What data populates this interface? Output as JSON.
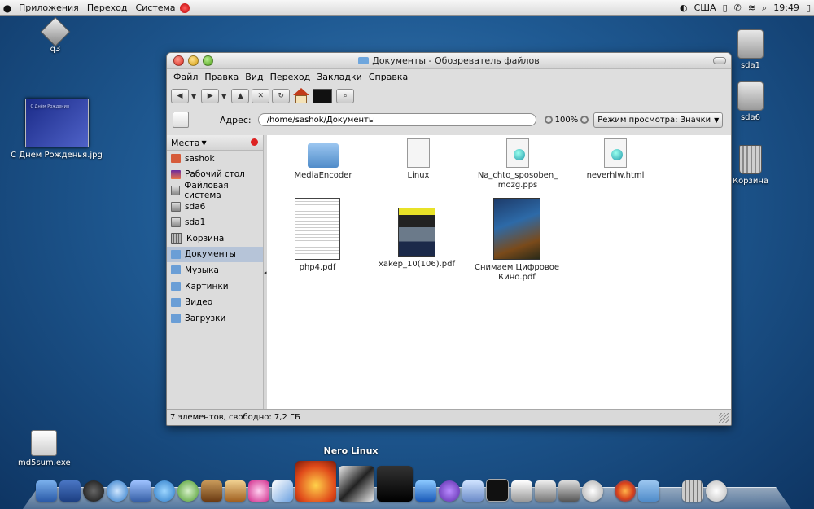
{
  "top_panel": {
    "menus": [
      "Приложения",
      "Переход",
      "Система"
    ],
    "keyboard_layout": "США",
    "time": "19:49"
  },
  "desktop": {
    "icons": {
      "q3": "q3",
      "birthday": "С Днем Рожденья.jpg",
      "birthday_thumb_text": "С Днём Рождения",
      "sda1": "sda1",
      "sda6": "sda6",
      "trash": "Корзина",
      "md5sum": "md5sum.exe"
    }
  },
  "window": {
    "title": "Документы - Обозреватель файлов",
    "menu": [
      "Файл",
      "Правка",
      "Вид",
      "Переход",
      "Закладки",
      "Справка"
    ],
    "address_label": "Адрес:",
    "address_value": "/home/sashok/Документы",
    "zoom": "100%",
    "view_mode": "Режим просмотра: Значки",
    "sidebar": {
      "header": "Места",
      "items": [
        "sashok",
        "Рабочий стол",
        "Файловая система",
        "sda6",
        "sda1",
        "Корзина",
        "Документы",
        "Музыка",
        "Картинки",
        "Видео",
        "Загрузки"
      ]
    },
    "files": [
      "MediaEncoder",
      "Linux",
      "Na_chto_sposoben_\nmozg.pps",
      "neverhlw.html",
      "php4.pdf",
      "xakep_10(106).pdf",
      "Снимаем Цифровое\nКино.pdf"
    ],
    "status": "7 элементов, свободно: 7,2 ГБ"
  },
  "dock": {
    "hover_label": "Nero Linux"
  }
}
